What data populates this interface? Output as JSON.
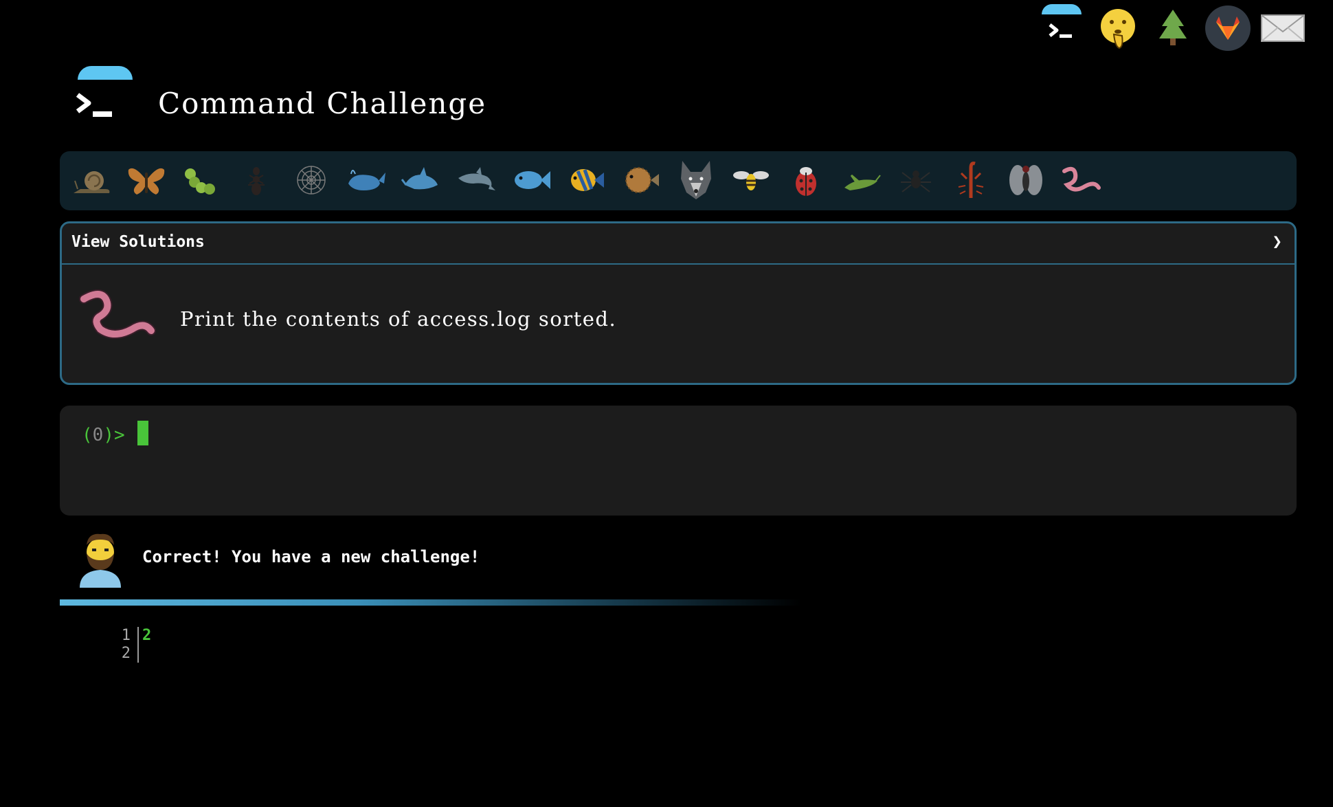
{
  "app": {
    "title": "Command Challenge"
  },
  "topnav": {
    "icons": [
      "terminal-logo-icon",
      "shushing-face-icon",
      "tree-icon",
      "gitlab-icon",
      "mail-icon"
    ]
  },
  "challenge_bar": {
    "icons": [
      "snail-icon",
      "butterfly-icon",
      "caterpillar-icon",
      "ant-icon",
      "spider-web-icon",
      "whale-icon",
      "shark-icon",
      "dolphin-icon",
      "fish-icon",
      "tropical-fish-icon",
      "blowfish-icon",
      "wolf-icon",
      "bee-icon",
      "ladybug-icon",
      "cricket-icon",
      "spider-icon",
      "scorpion-icon",
      "fly-icon",
      "worm-icon"
    ]
  },
  "panel": {
    "header_label": "View Solutions",
    "chevron": "❯",
    "task": "Print the contents of access.log sorted."
  },
  "terminal": {
    "prompt_open": "(",
    "exit_code": "0",
    "prompt_close": ")>"
  },
  "message": {
    "text": "Correct! You have a new challenge!"
  },
  "editor": {
    "gutter_line_1": "1",
    "gutter_line_2": "2",
    "line_1": "2"
  },
  "colors": {
    "accent": "#5ec6f2",
    "prompt_green": "#49c43a",
    "panel_border": "#2d6a86"
  }
}
